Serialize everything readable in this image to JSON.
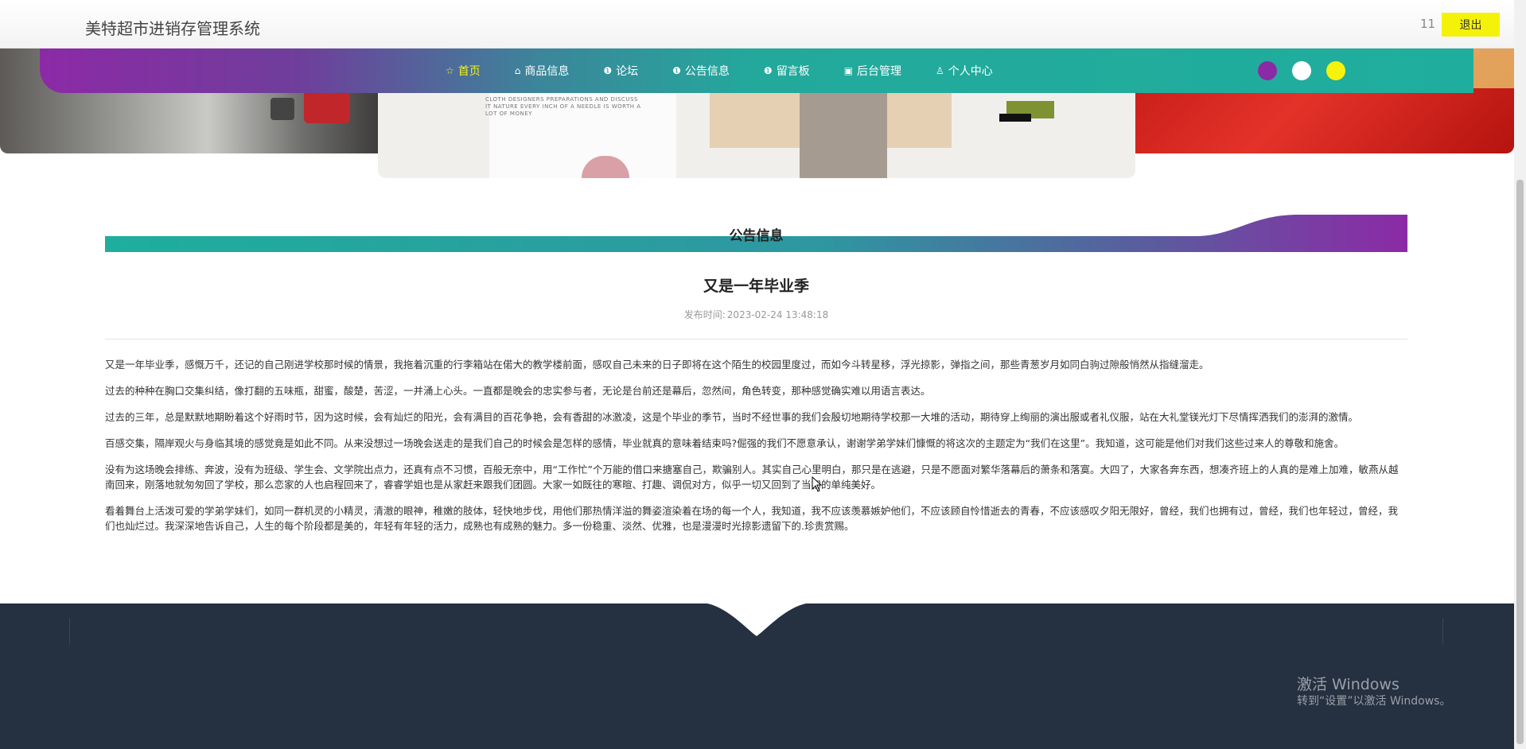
{
  "header": {
    "site_title": "美特超市进销存管理系统",
    "user_count": "11",
    "logout_label": "退出"
  },
  "nav": {
    "items": [
      {
        "label": "首页",
        "icon": "star-icon",
        "active": true
      },
      {
        "label": "商品信息",
        "icon": "home-icon",
        "active": false
      },
      {
        "label": "论坛",
        "icon": "info-icon",
        "active": false
      },
      {
        "label": "公告信息",
        "icon": "info-icon",
        "active": false
      },
      {
        "label": "留言板",
        "icon": "info-icon",
        "active": false
      },
      {
        "label": "后台管理",
        "icon": "briefcase-icon",
        "active": false
      },
      {
        "label": "个人中心",
        "icon": "user-icon",
        "active": false
      }
    ],
    "theme_colors": [
      "#8c2aa6",
      "#ffffff",
      "#f7f20c"
    ]
  },
  "section": {
    "title": "公告信息"
  },
  "article": {
    "title": "又是一年毕业季",
    "publish_label": "发布时间:",
    "publish_time": "2023-02-24 13:48:18",
    "paragraphs": [
      "又是一年毕业季，感慨万千，还记的自己刚进学校那时候的情景，我拖着沉重的行李箱站在偌大的教学楼前面，感叹自己未来的日子即将在这个陌生的校园里度过，而如今斗转星移，浮光掠影，弹指之间，那些青葱岁月如同白驹过隙般悄然从指缝溜走。",
      "过去的种种在胸口交集纠结，像打翻的五味瓶，甜蜜，酸楚，苦涩，一并涌上心头。一直都是晚会的忠实参与者，无论是台前还是幕后，忽然间，角色转变，那种感觉确实难以用语言表达。",
      "过去的三年，总是默默地期盼着这个好雨时节，因为这时候，会有灿烂的阳光，会有满目的百花争艳，会有香甜的冰激凌，这是个毕业的季节，当时不经世事的我们会殷切地期待学校那一大堆的活动，期待穿上绚丽的演出服或者礼仪服，站在大礼堂镁光灯下尽情挥洒我们的澎湃的激情。",
      "百感交集，隔岸观火与身临其境的感觉竟是如此不同。从来没想过一场晚会送走的是我们自己的时候会是怎样的感情，毕业就真的意味着结束吗?倔强的我们不愿意承认，谢谢学弟学妹们慷慨的将这次的主题定为“我们在这里”。我知道，这可能是他们对我们这些过来人的尊敬和施舍。",
      "没有为这场晚会排练、奔波，没有为班级、学生会、文学院出点力，还真有点不习惯，百般无奈中，用“工作忙”个万能的借口来搪塞自己，欺骗别人。其实自己心里明白，那只是在逃避，只是不愿面对繁华落幕后的萧条和落寞。大四了，大家各奔东西，想凑齐班上的人真的是难上加难，敏燕从越南回来，刚落地就匆匆回了学校，那么恋家的人也启程回来了，睿睿学姐也是从家赶来跟我们团圆。大家一如既往的寒暄、打趣、调侃对方，似乎一切又回到了当初的单纯美好。",
      "看着舞台上活泼可爱的学弟学妹们，如同一群机灵的小精灵，清澈的眼神，稚嫩的肢体，轻快地步伐，用他们那热情洋溢的舞姿渲染着在场的每一个人，我知道，我不应该羡慕嫉妒他们，不应该顾自怜惜逝去的青春，不应该感叹夕阳无限好，曾经，我们也拥有过，曾经，我们也年轻过，曾经，我们也灿烂过。我深深地告诉自己，人生的每个阶段都是美的，年轻有年轻的活力，成熟也有成熟的魅力。多一份稳重、淡然、优雅，也是漫漫时光掠影遗留下的.珍贵赏赐。"
    ]
  },
  "banner": {
    "promo_text": "CLOTH DESIGNERS PREPARATIONS AND DISCUSS IT NATURE EVERY INCH OF A NEEDLE IS WORTH A LOT OF MONEY"
  },
  "watermark": {
    "title": "激活 Windows",
    "subtitle": "转到“设置”以激活 Windows。"
  }
}
